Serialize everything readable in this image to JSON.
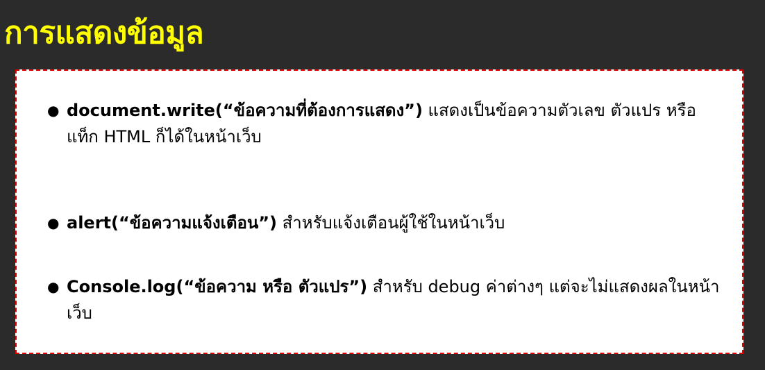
{
  "title": "การแสดงข้อมูล",
  "items": [
    {
      "code": "document.write(“ข้อความที่ต้องการแสดง”)",
      "text": " แสดงเป็นข้อความตัวเลข ตัวแปร หรือแท็ก HTML ก็ได้ในหน้าเว็บ"
    },
    {
      "code": "alert(“ข้อความแจ้งเตือน”)",
      "text": " สำหรับแจ้งเตือนผู้ใช้ในหน้าเว็บ"
    },
    {
      "code": "Console.log(“ข้อความ หรือ ตัวแปร”)",
      "text": " สำหรับ debug ค่าต่างๆ แต่จะไม่แสดงผลในหน้าเว็บ"
    }
  ],
  "bullet_glyph": "●"
}
